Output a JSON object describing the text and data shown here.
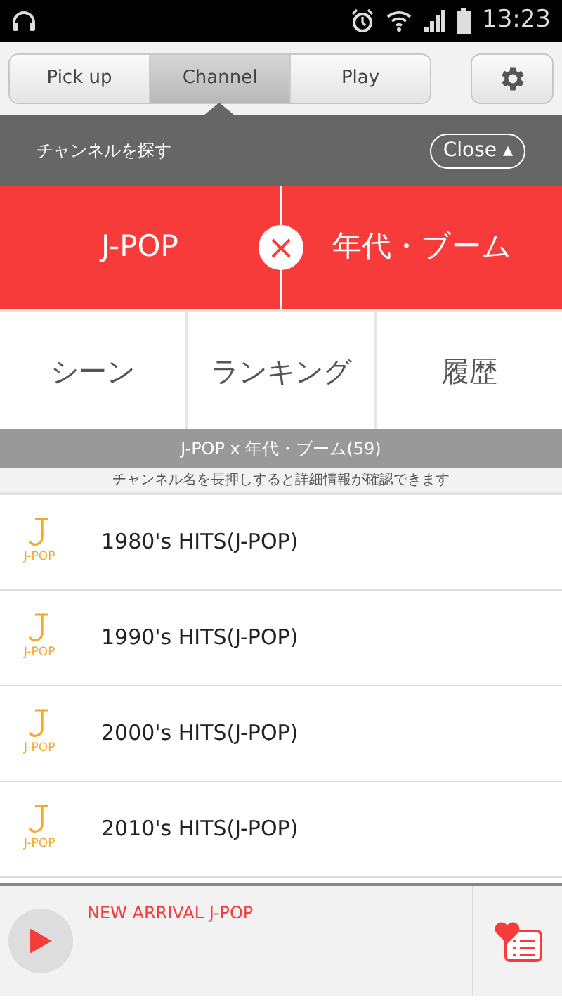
{
  "status_bar": {
    "time": "13:23"
  },
  "tabs": [
    {
      "label": "Pick up",
      "selected": false
    },
    {
      "label": "Channel",
      "selected": true
    },
    {
      "label": "Play",
      "selected": false
    }
  ],
  "panel": {
    "title": "チャンネルを探す",
    "close_label": "Close ▴"
  },
  "genre_row": {
    "left": "J-POP",
    "right": "年代・ブーム",
    "joiner": "×"
  },
  "categories": [
    "シーン",
    "ランキング",
    "履歴"
  ],
  "result_bar": {
    "title": "J-POP x 年代・ブーム(59)",
    "hint": "チャンネル名を長押しすると詳細情報が確認できます"
  },
  "channels": [
    {
      "badge": "J-POP",
      "name": "1980's HITS(J-POP)"
    },
    {
      "badge": "J-POP",
      "name": "1990's HITS(J-POP)"
    },
    {
      "badge": "J-POP",
      "name": "2000's HITS(J-POP)"
    },
    {
      "badge": "J-POP",
      "name": "2010's HITS(J-POP)"
    }
  ],
  "player": {
    "now_playing": "NEW ARRIVAL J-POP"
  }
}
